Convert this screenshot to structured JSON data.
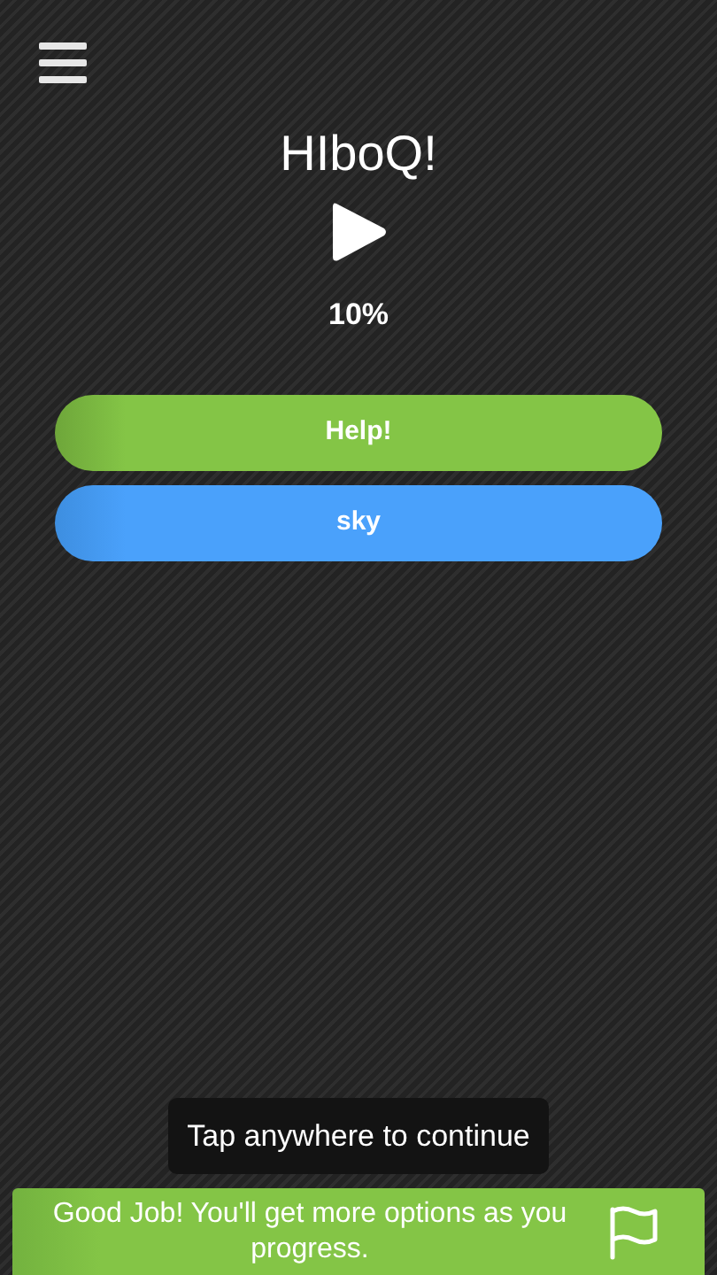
{
  "title": "HIboQ!",
  "progress": "10%",
  "buttons": [
    {
      "label": "Help!",
      "kind": "green"
    },
    {
      "label": "sky",
      "kind": "blue"
    }
  ],
  "toast": "Tap anywhere to continue",
  "banner": {
    "message": "Good Job! You'll get more options as you progress."
  }
}
